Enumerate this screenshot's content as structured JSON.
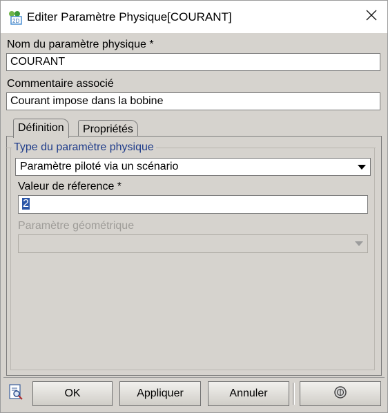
{
  "window": {
    "title": "Editer Paramètre Physique[COURANT]",
    "app_icon": "app-logo-icon",
    "close_icon": "close-icon"
  },
  "form": {
    "name_label": "Nom du paramètre physique *",
    "name_value": "COURANT",
    "comment_label": "Commentaire associé",
    "comment_value": "Courant impose dans la bobine"
  },
  "tabs": [
    {
      "label": "Définition",
      "active": true
    },
    {
      "label": "Propriétés",
      "active": false
    }
  ],
  "definition": {
    "group_label": "Type du paramètre physique",
    "type_selected": "Paramètre piloté via un scénario",
    "ref_label": "Valeur de réference *",
    "ref_value": "2",
    "geo_label": "Paramètre géométrique",
    "geo_value": ""
  },
  "footer": {
    "ok_label": "OK",
    "apply_label": "Appliquer",
    "cancel_label": "Annuler",
    "help_icon": "help-circle-icon",
    "left_icon": "document-search-icon"
  },
  "colors": {
    "dialog_bg": "#d6d3ce",
    "group_label": "#1f3c8a",
    "selection": "#2a55a7"
  }
}
